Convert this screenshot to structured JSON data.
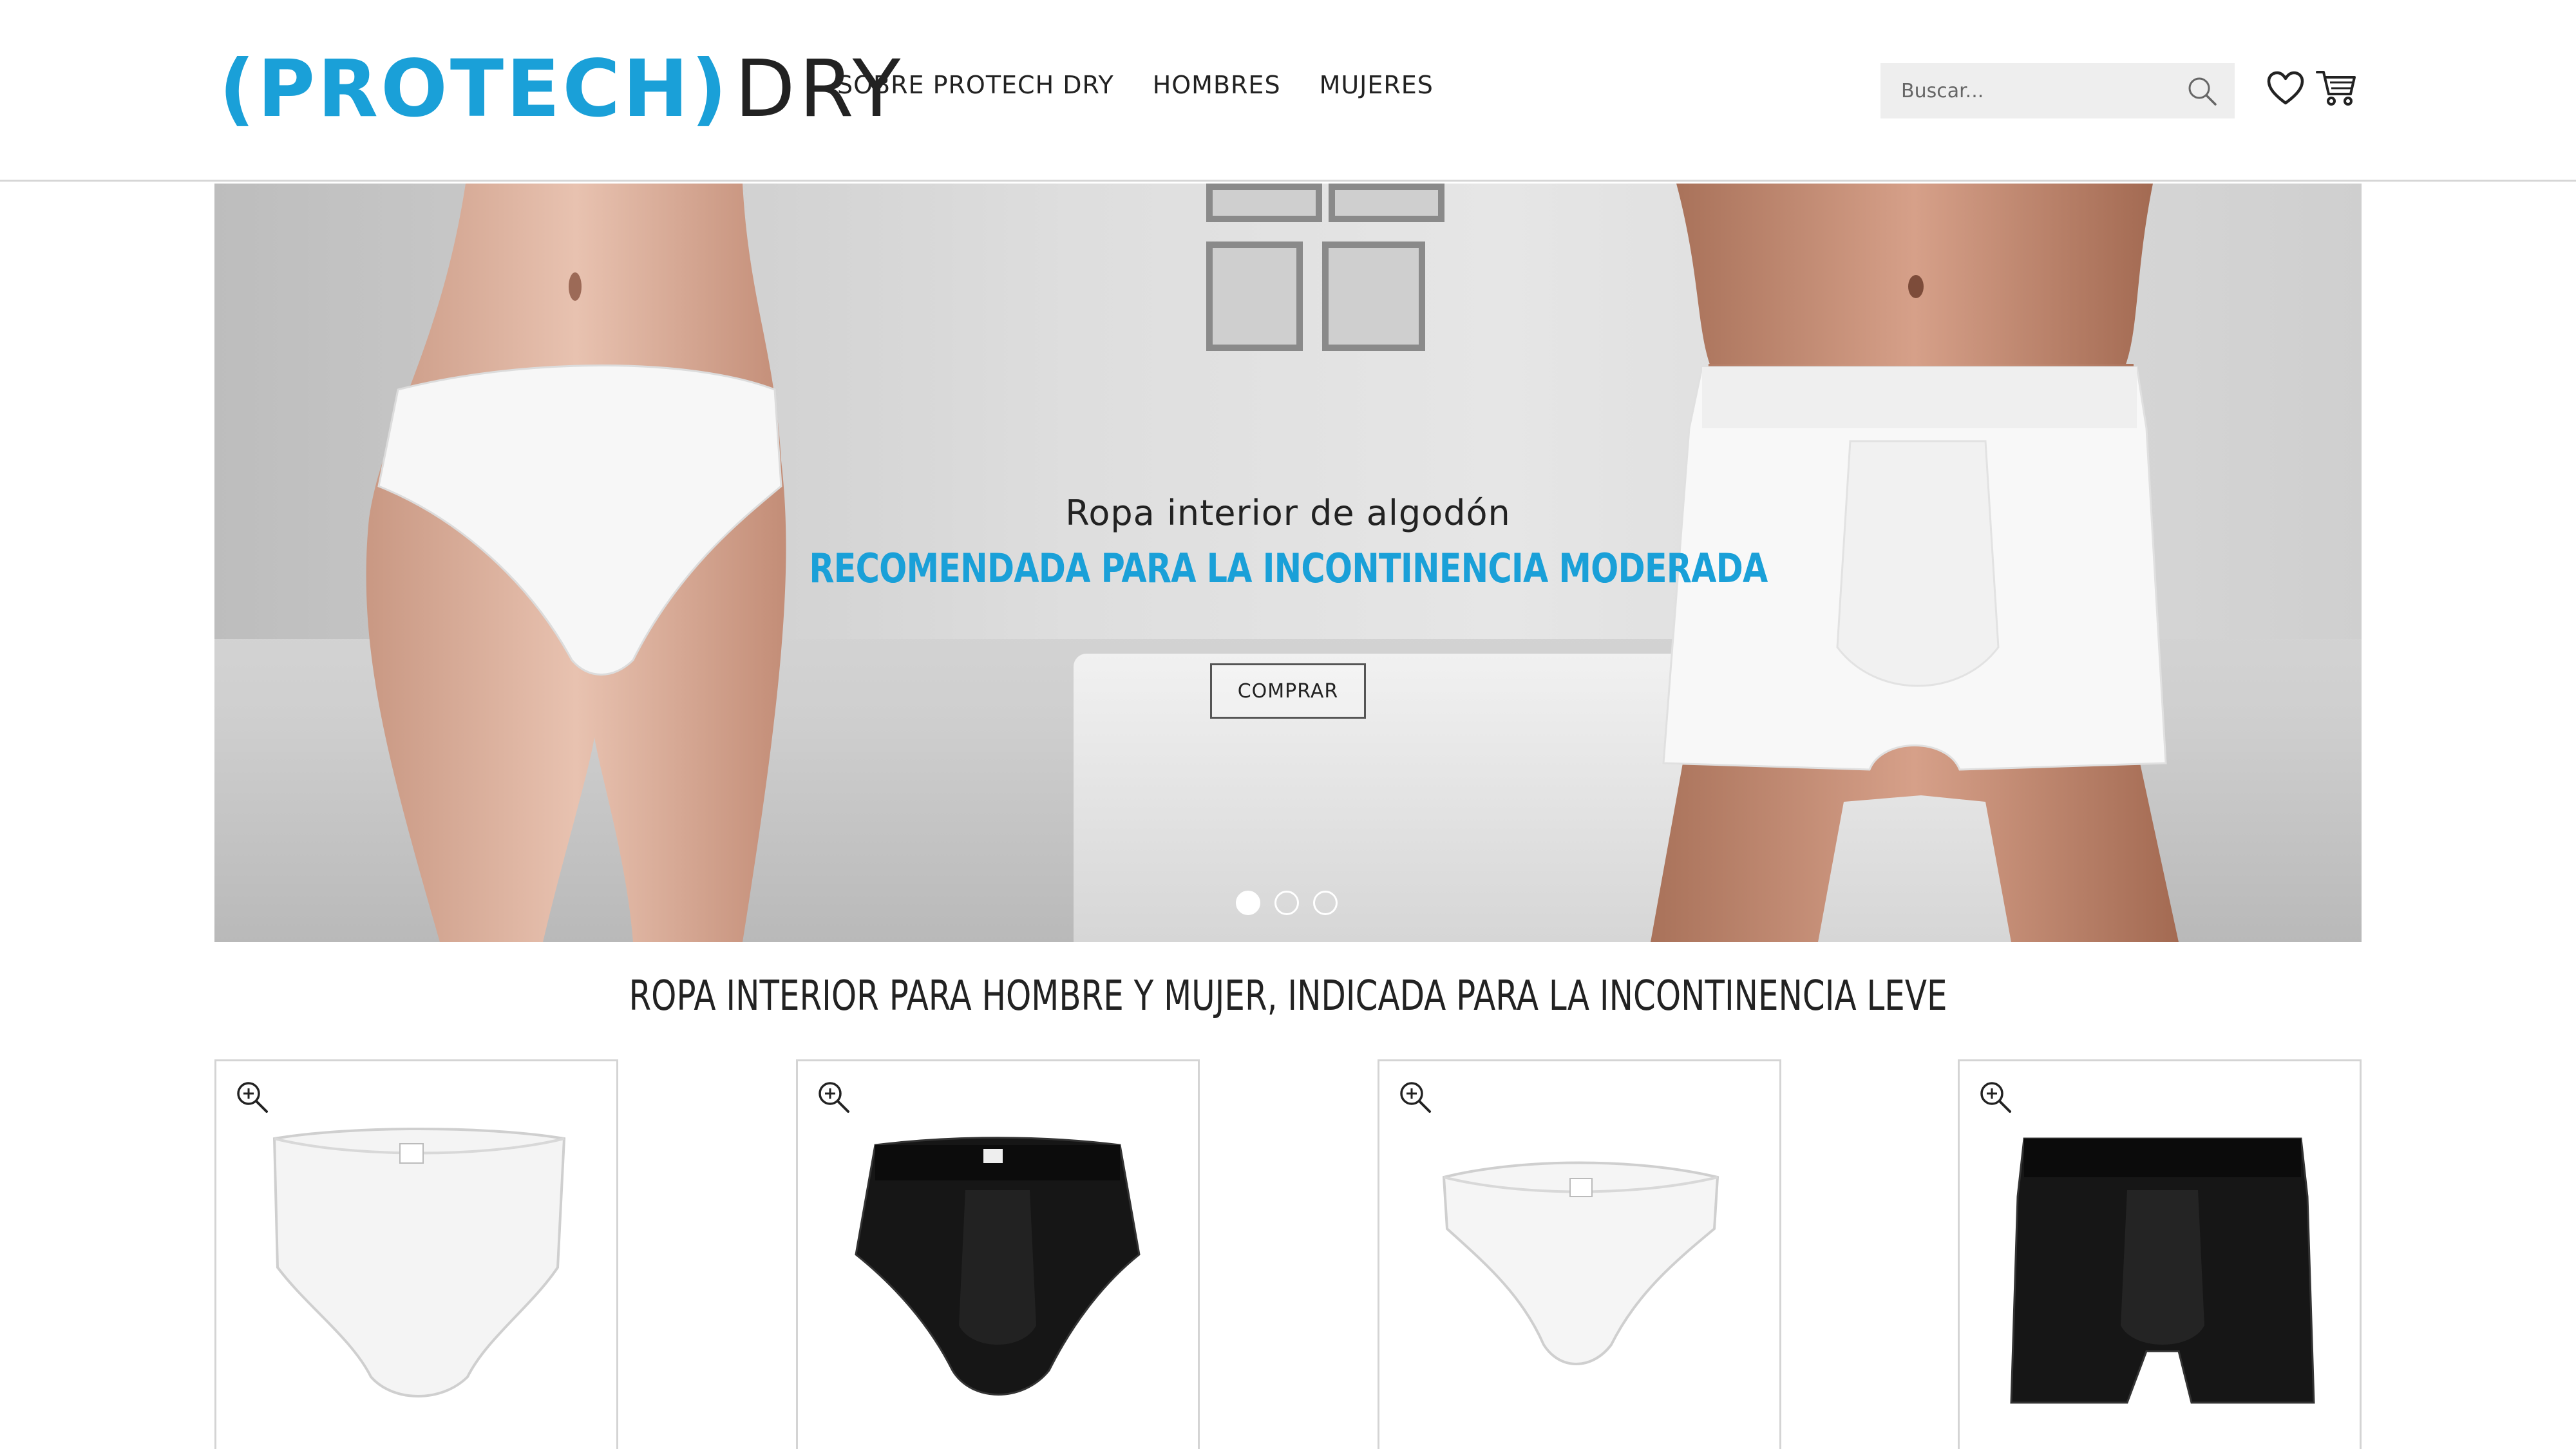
{
  "header": {
    "logo": {
      "brand": "(PROTECH)",
      "suffix": "DRY"
    },
    "nav": [
      {
        "label": "SOBRE PROTECH DRY"
      },
      {
        "label": "HOMBRES"
      },
      {
        "label": "MUJERES"
      }
    ],
    "search": {
      "placeholder": "Buscar...",
      "value": ""
    },
    "icons": [
      "search-icon",
      "heart-icon",
      "cart-icon"
    ]
  },
  "hero": {
    "subtitle": "Ropa interior de algodón",
    "headline": "RECOMENDADA PARA LA INCONTINENCIA MODERADA",
    "button_label": "COMPRAR",
    "slides": 3,
    "active_slide": 1
  },
  "section": {
    "title": "Ropa interior para hombre y mujer, indicada para la incontinencia leve"
  },
  "products": [
    {
      "color": "white",
      "style": "women-brief"
    },
    {
      "color": "black",
      "style": "men-brief"
    },
    {
      "color": "white",
      "style": "women-bikini"
    },
    {
      "color": "black",
      "style": "men-boxer"
    }
  ],
  "colors": {
    "accent": "#1aa0d8",
    "text": "#222222",
    "border": "#d4d4d4"
  }
}
